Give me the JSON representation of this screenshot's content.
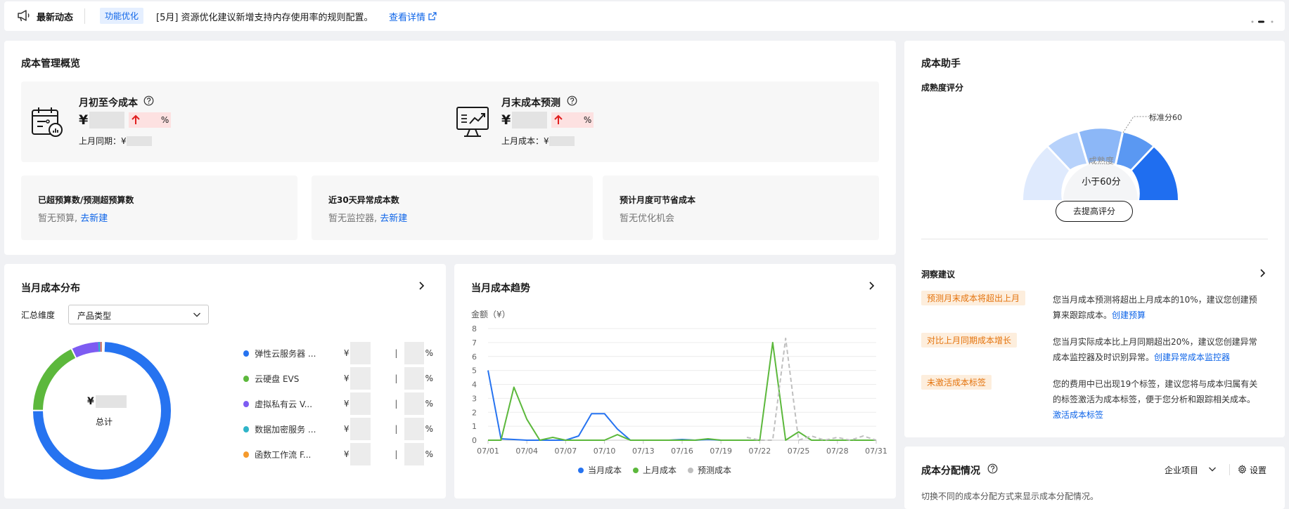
{
  "news": {
    "title": "最新动态",
    "tag": "功能优化",
    "text": "[5月] 资源优化建议新增支持内存使用率的规则配置。",
    "link": "查看详情"
  },
  "overview": {
    "title": "成本管理概览",
    "mtd": {
      "label": "月初至今成本",
      "currency": "¥",
      "pct": "%",
      "compare": "上月同期：¥"
    },
    "forecast": {
      "label": "月末成本预测",
      "currency": "¥",
      "pct": "%",
      "compare": "上月成本：¥"
    },
    "stats": [
      {
        "title": "已超预算数/预测超预算数",
        "text": "暂无预算,",
        "link": "去新建"
      },
      {
        "title": "近30天异常成本数",
        "text": "暂无监控器,",
        "link": "去新建"
      },
      {
        "title": "预计月度可节省成本",
        "text": "暂无优化机会",
        "link": ""
      }
    ]
  },
  "distribution": {
    "title": "当月成本分布",
    "dimension_label": "汇总维度",
    "dimension_value": "产品类型",
    "center_currency": "¥",
    "center_label": "总计",
    "legend": [
      {
        "name": "弹性云服务器 ...",
        "color": "#2673f0",
        "prefix": "¥",
        "sep": "|",
        "pct": "%"
      },
      {
        "name": "云硬盘 EVS",
        "color": "#5cb83c",
        "prefix": "¥",
        "sep": "|",
        "pct": "%"
      },
      {
        "name": "虚拟私有云 V...",
        "color": "#7d5cf2",
        "prefix": "¥",
        "sep": "|",
        "pct": "%"
      },
      {
        "name": "数据加密服务 ...",
        "color": "#2fb4c8",
        "prefix": "¥",
        "sep": "|",
        "pct": "%"
      },
      {
        "name": "函数工作流 F...",
        "color": "#f59a2c",
        "prefix": "¥",
        "sep": "|",
        "pct": "%"
      }
    ]
  },
  "chart_data": {
    "type": "line",
    "title": "当月成本趋势",
    "ylabel": "金额（¥）",
    "xlabel": "",
    "ylim": [
      0,
      8
    ],
    "yticks": [
      0,
      1,
      2,
      3,
      4,
      5,
      6,
      7,
      8
    ],
    "xticks": [
      "07/01",
      "07/04",
      "07/07",
      "07/10",
      "07/13",
      "07/16",
      "07/19",
      "07/22",
      "07/25",
      "07/28",
      "07/31"
    ],
    "x": [
      "07/01",
      "07/02",
      "07/03",
      "07/04",
      "07/05",
      "07/06",
      "07/07",
      "07/08",
      "07/09",
      "07/10",
      "07/11",
      "07/12",
      "07/13",
      "07/14",
      "07/15",
      "07/16",
      "07/17",
      "07/18",
      "07/19",
      "07/20",
      "07/21",
      "07/22",
      "07/23",
      "07/24",
      "07/25",
      "07/26",
      "07/27",
      "07/28",
      "07/29",
      "07/30",
      "07/31"
    ],
    "grid": true,
    "legend_position": "bottom",
    "series": [
      {
        "name": "当月成本",
        "color": "#2673f0",
        "dashed": false,
        "values": [
          5.0,
          0.1,
          0.05,
          0.0,
          0.0,
          0.0,
          0.0,
          0.3,
          1.9,
          1.9,
          0.8,
          0.0,
          0.0,
          0.0,
          0.0,
          0.05,
          0.0,
          0.05,
          0.0,
          0.0,
          0.0,
          null,
          null,
          null,
          null,
          null,
          null,
          null,
          null,
          null,
          null
        ]
      },
      {
        "name": "上月成本",
        "color": "#5cb83c",
        "dashed": false,
        "values": [
          0.0,
          0.0,
          3.8,
          1.5,
          0.0,
          0.2,
          0.0,
          0.0,
          0.0,
          0.0,
          0.4,
          0.0,
          0.0,
          0.0,
          0.0,
          0.0,
          0.0,
          0.1,
          0.0,
          0.0,
          0.0,
          0.0,
          7.0,
          0.0,
          0.6,
          0.0,
          0.0,
          0.0,
          0.0,
          0.0,
          0.0
        ]
      },
      {
        "name": "预测成本",
        "color": "#bfbfbf",
        "dashed": true,
        "values": [
          null,
          null,
          null,
          null,
          null,
          null,
          null,
          null,
          null,
          null,
          null,
          null,
          null,
          null,
          null,
          null,
          null,
          null,
          null,
          null,
          0.2,
          0.0,
          0.0,
          7.3,
          0.0,
          0.3,
          0.0,
          0.2,
          0.0,
          0.3,
          0.0
        ]
      }
    ]
  },
  "assistant": {
    "title": "成本助手",
    "maturity_title": "成熟度评分",
    "gauge_label": "成熟度",
    "gauge_value": "小于60分",
    "standard_label": "标准分60",
    "standard_score": 60,
    "improve_button": "去提高评分",
    "insight_title": "洞察建议",
    "insights": [
      {
        "tag": "预测月末成本将超出上月",
        "text": "您当月成本预测将超出上月成本的10%，建议您创建预算来跟踪成本。",
        "link": "创建预算"
      },
      {
        "tag": "对比上月同期成本增长",
        "text": "您当月实际成本比上月同期超出20%，建议您创建异常成本监控器及时识别异常。",
        "link": "创建异常成本监控器"
      },
      {
        "tag": "未激活成本标签",
        "text": "您的费用中已出现19个标签，建议您将与成本归属有关的标签激活为成本标签，便于您分析和跟踪相关成本。",
        "link": "激活成本标签"
      }
    ]
  },
  "allocation": {
    "title": "成本分配情况",
    "select": "企业项目",
    "settings": "设置",
    "desc": "切换不同的成本分配方式来显示成本分配情况。"
  }
}
